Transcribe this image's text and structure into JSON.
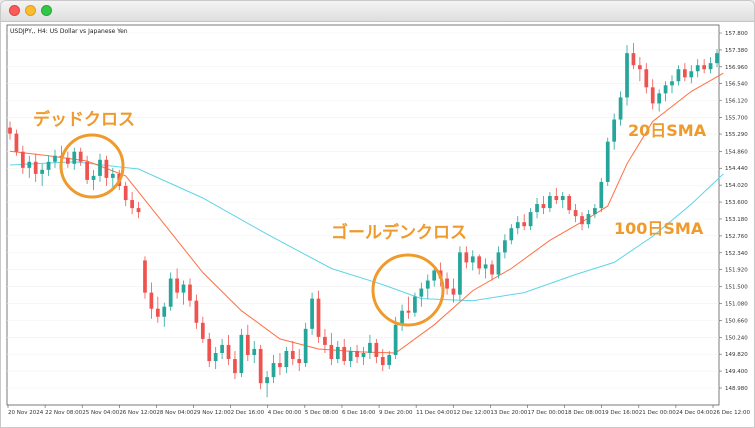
{
  "window": {
    "title": "",
    "symbol_caption": "USDJPY,, H4: US Dollar vs Japanese Yen"
  },
  "annotations": {
    "dead_cross": "デッドクロス",
    "golden_cross": "ゴールデンクロス",
    "sma20": "20日SMA",
    "sma100": "100日SMA",
    "circle_color": "#ef9a2c"
  },
  "colors": {
    "bull": "#26a69a",
    "bear": "#ef5350",
    "sma20": "#ff7043",
    "sma100": "#5fd4e8",
    "grid": "#f1f1f1"
  },
  "chart_data": {
    "type": "candlestick",
    "symbol": "USDJPY",
    "timeframe": "H4",
    "ylim": [
      148.48,
      157.8
    ],
    "y_ticks": [
      157.8,
      157.38,
      156.96,
      156.54,
      156.12,
      155.7,
      155.29,
      154.86,
      154.44,
      154.02,
      153.6,
      153.18,
      152.76,
      152.34,
      151.92,
      151.5,
      151.08,
      150.66,
      150.24,
      149.82,
      149.4,
      148.98
    ],
    "x_ticks": [
      "20 Nov 2024",
      "22 Nov 08:00",
      "25 Nov 04:00",
      "26 Nov 12:00",
      "28 Nov 04:00",
      "29 Nov 12:00",
      "2 Dec 16:00",
      "4 Dec 00:00",
      "5 Dec 08:00",
      "6 Dec 16:00",
      "9 Dec 20:00",
      "11 Dec 04:00",
      "12 Dec 12:00",
      "13 Dec 20:00",
      "17 Dec 00:00",
      "18 Dec 08:00",
      "19 Dec 16:00",
      "21 Dec 00:00",
      "24 Dec 04:00",
      "26 Dec 12:00"
    ],
    "candles": [
      [
        155.45,
        155.6,
        155.15,
        155.3
      ],
      [
        155.3,
        155.4,
        154.75,
        154.85
      ],
      [
        154.85,
        155.0,
        154.3,
        154.45
      ],
      [
        154.45,
        154.75,
        154.2,
        154.6
      ],
      [
        154.6,
        154.8,
        154.1,
        154.3
      ],
      [
        154.3,
        154.55,
        154.0,
        154.4
      ],
      [
        154.4,
        154.75,
        154.25,
        154.6
      ],
      [
        154.6,
        154.9,
        154.45,
        154.75
      ],
      [
        154.75,
        155.0,
        154.55,
        154.7
      ],
      [
        154.7,
        154.85,
        154.45,
        154.55
      ],
      [
        154.55,
        154.95,
        154.4,
        154.85
      ],
      [
        154.85,
        154.95,
        154.5,
        154.6
      ],
      [
        154.6,
        154.75,
        154.05,
        154.15
      ],
      [
        154.15,
        154.4,
        153.9,
        154.25
      ],
      [
        154.25,
        154.8,
        154.1,
        154.65
      ],
      [
        154.65,
        154.75,
        154.0,
        154.2
      ],
      [
        154.2,
        154.45,
        153.95,
        154.3
      ],
      [
        154.3,
        154.4,
        153.9,
        154.0
      ],
      [
        154.0,
        154.1,
        153.5,
        153.65
      ],
      [
        153.65,
        153.85,
        153.3,
        153.45
      ],
      [
        153.45,
        153.6,
        153.2,
        153.35
      ],
      [
        152.15,
        152.25,
        151.2,
        151.35
      ],
      [
        151.35,
        151.6,
        150.7,
        150.95
      ],
      [
        150.95,
        151.25,
        150.6,
        150.75
      ],
      [
        150.75,
        151.1,
        150.5,
        151.0
      ],
      [
        151.0,
        151.85,
        150.9,
        151.7
      ],
      [
        151.7,
        151.95,
        151.2,
        151.35
      ],
      [
        151.35,
        151.65,
        151.05,
        151.55
      ],
      [
        151.55,
        151.7,
        151.0,
        151.15
      ],
      [
        151.15,
        151.3,
        150.45,
        150.6
      ],
      [
        150.6,
        150.75,
        150.1,
        150.2
      ],
      [
        150.2,
        150.35,
        149.5,
        149.65
      ],
      [
        149.65,
        150.0,
        149.45,
        149.85
      ],
      [
        149.85,
        150.2,
        149.7,
        150.05
      ],
      [
        150.05,
        150.3,
        149.55,
        149.7
      ],
      [
        149.7,
        149.9,
        149.2,
        149.35
      ],
      [
        149.35,
        150.45,
        149.25,
        150.3
      ],
      [
        150.3,
        150.55,
        149.65,
        149.8
      ],
      [
        149.8,
        150.15,
        149.6,
        149.95
      ],
      [
        149.95,
        150.05,
        148.95,
        149.1
      ],
      [
        149.1,
        149.4,
        148.75,
        149.25
      ],
      [
        149.25,
        149.8,
        149.1,
        149.6
      ],
      [
        149.6,
        149.85,
        149.3,
        149.5
      ],
      [
        149.5,
        150.0,
        149.35,
        149.9
      ],
      [
        149.9,
        150.15,
        149.55,
        149.7
      ],
      [
        149.7,
        149.95,
        149.4,
        149.6
      ],
      [
        149.6,
        150.6,
        149.5,
        150.45
      ],
      [
        150.45,
        151.35,
        150.3,
        151.2
      ],
      [
        151.2,
        151.4,
        150.1,
        150.25
      ],
      [
        150.25,
        150.45,
        149.85,
        150.05
      ],
      [
        150.05,
        150.35,
        149.55,
        149.7
      ],
      [
        149.7,
        150.15,
        149.6,
        150.0
      ],
      [
        150.0,
        150.2,
        149.55,
        149.65
      ],
      [
        149.65,
        150.0,
        149.5,
        149.9
      ],
      [
        149.9,
        150.05,
        149.6,
        149.75
      ],
      [
        149.75,
        150.0,
        149.55,
        149.85
      ],
      [
        149.85,
        150.3,
        149.7,
        150.1
      ],
      [
        150.1,
        150.2,
        149.6,
        149.75
      ],
      [
        149.75,
        149.95,
        149.4,
        149.55
      ],
      [
        149.55,
        149.9,
        149.45,
        149.8
      ],
      [
        149.8,
        150.75,
        149.7,
        150.55
      ],
      [
        150.55,
        151.05,
        150.4,
        150.9
      ],
      [
        150.9,
        151.25,
        150.7,
        150.85
      ],
      [
        150.85,
        151.35,
        150.75,
        151.25
      ],
      [
        151.25,
        151.6,
        151.0,
        151.45
      ],
      [
        151.45,
        151.8,
        151.2,
        151.65
      ],
      [
        151.65,
        152.0,
        151.5,
        151.9
      ],
      [
        151.9,
        152.1,
        151.5,
        151.7
      ],
      [
        151.7,
        151.85,
        151.3,
        151.45
      ],
      [
        151.45,
        151.7,
        151.1,
        151.3
      ],
      [
        151.3,
        152.5,
        151.15,
        152.35
      ],
      [
        152.35,
        152.5,
        151.95,
        152.1
      ],
      [
        152.1,
        152.4,
        151.9,
        152.25
      ],
      [
        152.25,
        152.3,
        151.8,
        151.95
      ],
      [
        151.95,
        152.2,
        151.7,
        152.05
      ],
      [
        152.05,
        152.15,
        151.65,
        151.8
      ],
      [
        151.8,
        152.5,
        151.7,
        152.35
      ],
      [
        152.35,
        152.8,
        152.2,
        152.65
      ],
      [
        152.65,
        153.05,
        152.55,
        152.95
      ],
      [
        152.95,
        153.25,
        152.8,
        153.1
      ],
      [
        153.1,
        153.3,
        152.9,
        153.0
      ],
      [
        153.0,
        153.45,
        152.9,
        153.35
      ],
      [
        153.35,
        153.7,
        153.2,
        153.55
      ],
      [
        153.55,
        153.75,
        153.3,
        153.45
      ],
      [
        153.45,
        153.85,
        153.35,
        153.75
      ],
      [
        153.75,
        153.95,
        153.55,
        153.65
      ],
      [
        153.65,
        153.85,
        153.45,
        153.75
      ],
      [
        153.75,
        153.8,
        153.3,
        153.4
      ],
      [
        153.4,
        153.55,
        153.1,
        153.25
      ],
      [
        153.25,
        153.35,
        152.9,
        153.05
      ],
      [
        153.05,
        153.4,
        152.95,
        153.3
      ],
      [
        153.3,
        153.55,
        153.2,
        153.45
      ],
      [
        153.45,
        154.2,
        153.35,
        154.1
      ],
      [
        154.1,
        155.2,
        154.0,
        155.1
      ],
      [
        155.1,
        155.8,
        154.9,
        155.65
      ],
      [
        155.65,
        156.35,
        155.5,
        156.2
      ],
      [
        156.2,
        157.5,
        156.0,
        157.3
      ],
      [
        157.3,
        157.55,
        156.9,
        157.0
      ],
      [
        157.0,
        157.2,
        156.6,
        156.9
      ],
      [
        156.9,
        157.05,
        156.3,
        156.45
      ],
      [
        156.45,
        156.65,
        155.9,
        156.05
      ],
      [
        156.05,
        156.4,
        155.85,
        156.3
      ],
      [
        156.3,
        156.6,
        156.1,
        156.5
      ],
      [
        156.5,
        156.75,
        156.3,
        156.6
      ],
      [
        156.6,
        157.0,
        156.5,
        156.9
      ],
      [
        156.9,
        157.05,
        156.6,
        156.7
      ],
      [
        156.7,
        157.0,
        156.55,
        156.85
      ],
      [
        156.85,
        157.15,
        156.7,
        157.0
      ],
      [
        157.0,
        157.15,
        156.8,
        156.9
      ],
      [
        156.9,
        157.2,
        156.8,
        157.05
      ],
      [
        157.05,
        157.4,
        156.95,
        157.3
      ]
    ],
    "sma20": [
      [
        0,
        154.86
      ],
      [
        6,
        154.75
      ],
      [
        12,
        154.62
      ],
      [
        18,
        154.25
      ],
      [
        24,
        153.05
      ],
      [
        30,
        151.85
      ],
      [
        36,
        150.9
      ],
      [
        42,
        150.2
      ],
      [
        48,
        149.95
      ],
      [
        54,
        149.88
      ],
      [
        60,
        149.85
      ],
      [
        66,
        150.55
      ],
      [
        72,
        151.4
      ],
      [
        78,
        151.95
      ],
      [
        84,
        152.65
      ],
      [
        90,
        153.2
      ],
      [
        93,
        153.5
      ],
      [
        96,
        154.55
      ],
      [
        100,
        155.6
      ],
      [
        106,
        156.35
      ],
      [
        111,
        156.8
      ]
    ],
    "sma100": [
      [
        0,
        154.52
      ],
      [
        10,
        154.6
      ],
      [
        20,
        154.42
      ],
      [
        30,
        153.7
      ],
      [
        40,
        152.8
      ],
      [
        50,
        151.95
      ],
      [
        58,
        151.55
      ],
      [
        64,
        151.2
      ],
      [
        72,
        151.15
      ],
      [
        80,
        151.35
      ],
      [
        88,
        151.8
      ],
      [
        94,
        152.1
      ],
      [
        100,
        152.75
      ],
      [
        106,
        153.55
      ],
      [
        111,
        154.3
      ]
    ]
  }
}
